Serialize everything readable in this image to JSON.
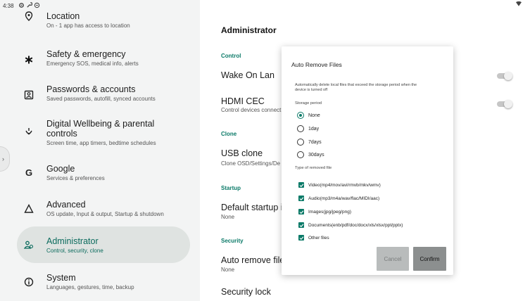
{
  "status": {
    "time": "4:38"
  },
  "nav": [
    {
      "title": "Location",
      "sub": "On - 1 app has access to location",
      "icon": "location-pin-icon"
    },
    {
      "title": "Safety & emergency",
      "sub": "Emergency SOS, medical info, alerts",
      "icon": "asterisk-icon"
    },
    {
      "title": "Passwords & accounts",
      "sub": "Saved passwords, autofill, synced accounts",
      "icon": "account-box-icon"
    },
    {
      "title": "Digital Wellbeing & parental controls",
      "sub": "Screen time, app timers, bedtime schedules",
      "icon": "wellbeing-icon"
    },
    {
      "title": "Google",
      "sub": "Services & preferences",
      "icon": "google-icon"
    },
    {
      "title": "Advanced",
      "sub": "OS update, Input & output, Startup & shutdown",
      "icon": "advanced-icon"
    },
    {
      "title": "Administrator",
      "sub": "Control, security, clone",
      "icon": "admin-icon"
    },
    {
      "title": "System",
      "sub": "Languages, gestures, time, backup",
      "icon": "info-icon"
    }
  ],
  "main": {
    "title": "Administrator",
    "sections": {
      "control": "Control",
      "clone": "Clone",
      "startup": "Startup",
      "security": "Security"
    },
    "settings": {
      "wake_on_lan": "Wake On Lan",
      "hdmi_cec": "HDMI CEC",
      "hdmi_cec_sub": "Control devices connect",
      "usb_clone": "USB clone",
      "usb_clone_sub": "Clone OSD/Settings/De",
      "default_startup": "Default startup i",
      "default_startup_sub": "None",
      "auto_remove": "Auto remove file",
      "auto_remove_sub": "None",
      "security_lock": "Security lock"
    }
  },
  "dialog": {
    "title": "Auto Remove Files",
    "description": "Automatically delete local files that exceed the storage period when the device is turned off",
    "storage_label": "Storage period",
    "storage_options": [
      "None",
      "1day",
      "7days",
      "30days"
    ],
    "storage_selected": "None",
    "type_label": "Type of removed file",
    "file_types": [
      "Video(mp4/mov/avi/rmvb/mkv/wmv)",
      "Audio(mp3/m4a/wav/flac/MIDI/aac)",
      "Images(jpg/jpeg/png)",
      "Documents(enb/pdf/doc/docx/xls/xlsx/ppt/pptx)",
      "Other files"
    ],
    "cancel_label": "Cancel",
    "confirm_label": "Confirm"
  },
  "colors": {
    "accent": "#0b7a68",
    "active_bg": "#dfe3e1",
    "panel_bg": "#f3f4f4"
  }
}
